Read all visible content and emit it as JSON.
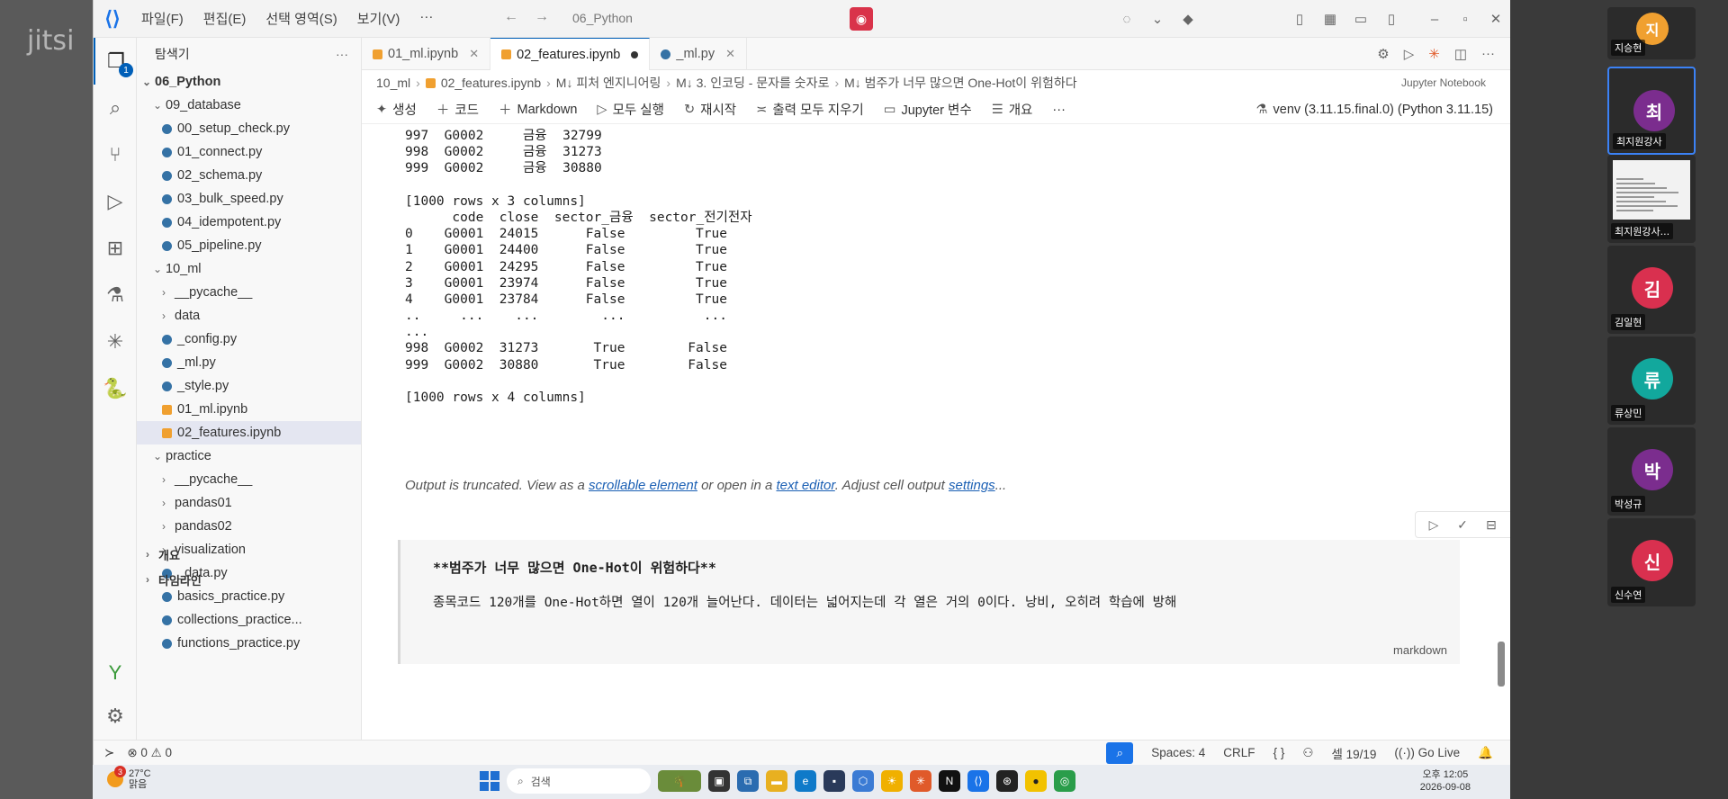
{
  "watermark": "jitsi",
  "titlebar": {
    "menu": [
      "파일(F)",
      "편집(E)",
      "선택 영역(S)",
      "보기(V)",
      "···"
    ],
    "title": "06_Python"
  },
  "explorer": {
    "header": "탐색기",
    "root": "06_Python",
    "tree": [
      {
        "label": "09_database",
        "kind": "folder-open",
        "depth": 1
      },
      {
        "label": "00_setup_check.py",
        "kind": "py",
        "depth": 2
      },
      {
        "label": "01_connect.py",
        "kind": "py",
        "depth": 2
      },
      {
        "label": "02_schema.py",
        "kind": "py",
        "depth": 2
      },
      {
        "label": "03_bulk_speed.py",
        "kind": "py",
        "depth": 2
      },
      {
        "label": "04_idempotent.py",
        "kind": "py",
        "depth": 2
      },
      {
        "label": "05_pipeline.py",
        "kind": "py",
        "depth": 2
      },
      {
        "label": "10_ml",
        "kind": "folder-open",
        "depth": 1
      },
      {
        "label": "__pycache__",
        "kind": "folder",
        "depth": 2
      },
      {
        "label": "data",
        "kind": "folder",
        "depth": 2
      },
      {
        "label": "_config.py",
        "kind": "py",
        "depth": 2
      },
      {
        "label": "_ml.py",
        "kind": "py",
        "depth": 2
      },
      {
        "label": "_style.py",
        "kind": "py",
        "depth": 2
      },
      {
        "label": "01_ml.ipynb",
        "kind": "nb",
        "depth": 2
      },
      {
        "label": "02_features.ipynb",
        "kind": "nb",
        "depth": 2,
        "selected": true
      },
      {
        "label": "practice",
        "kind": "folder-open",
        "depth": 1
      },
      {
        "label": "__pycache__",
        "kind": "folder",
        "depth": 2
      },
      {
        "label": "pandas01",
        "kind": "folder",
        "depth": 2
      },
      {
        "label": "pandas02",
        "kind": "folder",
        "depth": 2
      },
      {
        "label": "visualization",
        "kind": "folder",
        "depth": 2
      },
      {
        "label": "_data.py",
        "kind": "py",
        "depth": 2
      },
      {
        "label": "basics_practice.py",
        "kind": "py",
        "depth": 2
      },
      {
        "label": "collections_practice...",
        "kind": "py",
        "depth": 2
      },
      {
        "label": "functions_practice.py",
        "kind": "py",
        "depth": 2
      }
    ],
    "outline": "개요",
    "timeline": "타임라인"
  },
  "tabs": [
    {
      "label": "01_ml.ipynb",
      "active": false,
      "dirty": false
    },
    {
      "label": "02_features.ipynb",
      "active": true,
      "dirty": true
    },
    {
      "label": "_ml.py",
      "active": false,
      "dirty": false
    }
  ],
  "breadcrumb": {
    "items": [
      "10_ml",
      "02_features.ipynb",
      "M↓ 피처 엔지니어링",
      "M↓ 3. 인코딩 - 문자를 숫자로",
      "M↓ 범주가 너무 많으면 One-Hot이 위험하다"
    ],
    "kernel_type": "Jupyter Notebook"
  },
  "notebook_toolbar": {
    "items": [
      "생성",
      "코드",
      "Markdown",
      "모두 실행",
      "재시작",
      "출력 모두 지우기",
      "Jupyter 변수",
      "개요"
    ],
    "more": "···",
    "env": "venv (3.11.15.final.0) (Python 3.11.15)"
  },
  "output": {
    "lines": [
      "997  G0002     금융  32799",
      "998  G0002     금융  31273",
      "999  G0002     금융  30880",
      "",
      "[1000 rows x 3 columns]",
      "      code  close  sector_금융  sector_전기전자",
      "0    G0001  24015      False         True",
      "1    G0001  24400      False         True",
      "2    G0001  24295      False         True",
      "3    G0001  23974      False         True",
      "4    G0001  23784      False         True",
      "..     ...    ...        ...          ...",
      "...",
      "998  G0002  31273       True        False",
      "999  G0002  30880       True        False",
      "",
      "[1000 rows x 4 columns]"
    ],
    "truncated": {
      "prefix": "Output is truncated. View as a ",
      "link1": "scrollable element",
      "mid1": " or open in a ",
      "link2": "text editor",
      "mid2": ". Adjust cell output ",
      "link3": "settings",
      "suffix": "..."
    }
  },
  "markdown_cell": {
    "line1": "**범주가 너무 많으면 One-Hot이 위험하다**",
    "line2": "종목코드 120개를 One-Hot하면 열이 120개 늘어난다. 데이터는 넓어지는데 각 열은 거의 0이다. 낭비, 오히려 학습에 방해",
    "language": "markdown"
  },
  "statusbar": {
    "problems": "⊗ 0 ⚠ 0",
    "spaces": "Spaces: 4",
    "eol": "CRLF",
    "braces": "{ }",
    "cell": "셀 19/19",
    "golive": "Go Live"
  },
  "taskbar": {
    "temp": "27°C",
    "weather": "맑음",
    "notif_count": "3",
    "search": "검색",
    "time": "오후 12:05",
    "date": "2026-09-08"
  },
  "participants": [
    {
      "initial": "지",
      "name": "지승현",
      "color": "#f0a030"
    },
    {
      "initial": "최",
      "name": "최지원강사",
      "color": "#7b2d8e",
      "speaker": true
    },
    {
      "initial": "",
      "name": "최지원강사...",
      "screen": true
    },
    {
      "initial": "김",
      "name": "김일현",
      "color": "#d9304f"
    },
    {
      "initial": "류",
      "name": "류상민",
      "color": "#12a89d"
    },
    {
      "initial": "박",
      "name": "박성규",
      "color": "#7b2d8e"
    },
    {
      "initial": "신",
      "name": "신수연",
      "color": "#d9304f"
    }
  ]
}
